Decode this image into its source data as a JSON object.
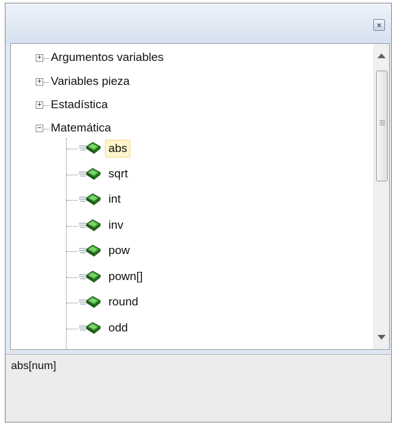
{
  "window": {
    "close_symbol": "×"
  },
  "tree": {
    "categories": [
      {
        "label": "Argumentos variables",
        "expanded": false,
        "expander": "+"
      },
      {
        "label": "Variables pieza",
        "expanded": false,
        "expander": "+"
      },
      {
        "label": "Estadística",
        "expanded": false,
        "expander": "+"
      },
      {
        "label": "Matemática",
        "expanded": true,
        "expander": "−"
      }
    ],
    "functions": [
      {
        "label": "abs",
        "selected": true
      },
      {
        "label": "sqrt"
      },
      {
        "label": "int"
      },
      {
        "label": "inv"
      },
      {
        "label": "pow"
      },
      {
        "label": "pown[]"
      },
      {
        "label": "round"
      },
      {
        "label": "odd"
      }
    ]
  },
  "description": {
    "text": "abs[num]"
  },
  "colors": {
    "panel": "#dfe8f4",
    "selection": "#fef5cb",
    "icon_green": "#3a9a2f"
  }
}
